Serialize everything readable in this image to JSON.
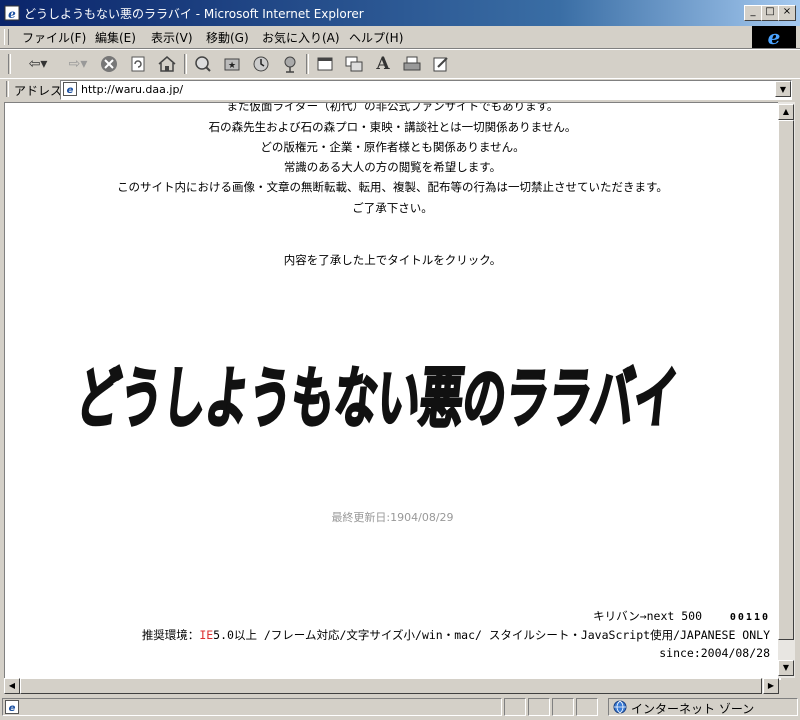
{
  "window": {
    "title": "どうしようもない悪のララバイ - Microsoft Internet Explorer",
    "caption_buttons": [
      "_",
      "□",
      "×"
    ]
  },
  "menu": [
    "ファイル(F)",
    "編集(E)",
    "表示(V)",
    "移動(G)",
    "お気に入り(A)",
    "ヘルプ(H)"
  ],
  "toolbar": {
    "icons": [
      "back-icon",
      "forward-icon",
      "stop-icon",
      "refresh-icon",
      "home-icon",
      "search-icon",
      "favorites-icon",
      "history-icon",
      "channels-icon",
      "fullscreen-icon",
      "mail-icon",
      "font-icon",
      "print-icon",
      "edit-icon"
    ]
  },
  "address": {
    "label": "アドレス",
    "url": "http://waru.daa.jp/"
  },
  "content": {
    "lines": [
      "また仮面ライダー（初代）の非公式ファンサイトでもあります。",
      "石の森先生および石の森プロ・東映・講談社とは一切関係ありません。",
      "どの版権元・企業・原作者様とも関係ありません。",
      "常識のある大人の方の閲覧を希望します。",
      "このサイト内における画像・文章の無断転載、転用、複製、配布等の行為は一切禁止させていただきます。",
      "ご了承下さい。"
    ],
    "instruction": "内容を了承した上でタイトルをクリック。",
    "logo_text": "どうしようもない悪のララバイ",
    "last_updated": "最終更新日:1904/08/29",
    "kiriban": "キリバン→next 500",
    "counter": "00110",
    "env_prefix": "推奨環境：",
    "env_ie": "IE",
    "env_rest": "5.0以上 /フレーム対応/文字サイズ小/win・mac/ スタイルシート・JavaScript使用/JAPANESE ONLY",
    "since": "since:2004/08/28"
  },
  "status": {
    "zone": "インターネット ゾーン"
  }
}
